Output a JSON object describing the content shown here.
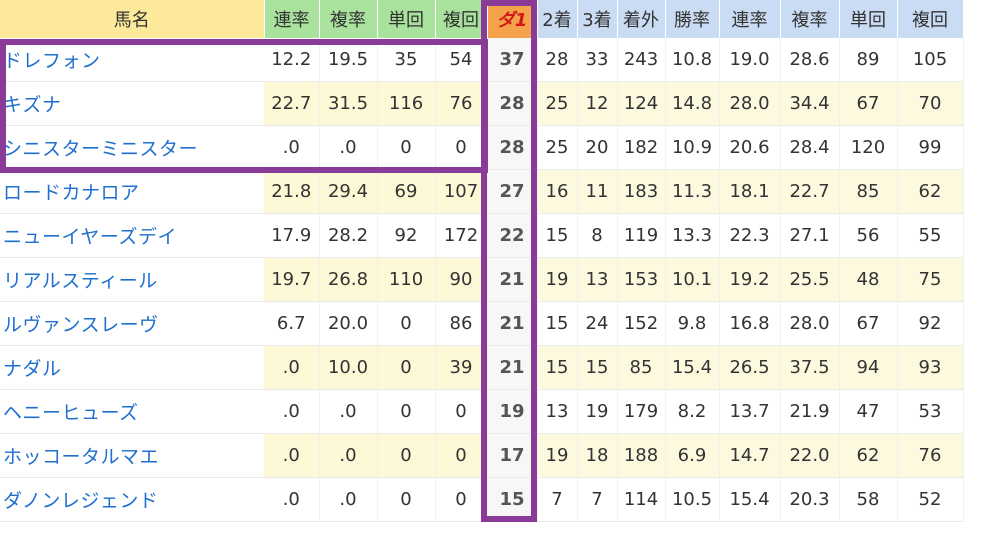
{
  "headers": {
    "name": "馬名",
    "g1": "連率",
    "g2": "複率",
    "g3": "単回",
    "g4": "複回",
    "d1": "ダ1",
    "b1": "2着",
    "b2": "3着",
    "b3": "着外",
    "b4": "勝率",
    "b5": "連率",
    "b6": "複率",
    "b7": "単回",
    "b8": "複回"
  },
  "rows": [
    {
      "name": "ドレフォン",
      "g1": "12.2",
      "g2": "19.5",
      "g3": "35",
      "g4": "54",
      "d1": "37",
      "b1": "28",
      "b2": "33",
      "b3": "243",
      "b4": "10.8",
      "b5": "19.0",
      "b6": "28.6",
      "b7": "89",
      "b8": "105"
    },
    {
      "name": "キズナ",
      "g1": "22.7",
      "g2": "31.5",
      "g3": "116",
      "g4": "76",
      "d1": "28",
      "b1": "25",
      "b2": "12",
      "b3": "124",
      "b4": "14.8",
      "b5": "28.0",
      "b6": "34.4",
      "b7": "67",
      "b8": "70"
    },
    {
      "name": "シニスターミニスター",
      "g1": ".0",
      "g2": ".0",
      "g3": "0",
      "g4": "0",
      "d1": "28",
      "b1": "25",
      "b2": "20",
      "b3": "182",
      "b4": "10.9",
      "b5": "20.6",
      "b6": "28.4",
      "b7": "120",
      "b8": "99"
    },
    {
      "name": "ロードカナロア",
      "g1": "21.8",
      "g2": "29.4",
      "g3": "69",
      "g4": "107",
      "d1": "27",
      "b1": "16",
      "b2": "11",
      "b3": "183",
      "b4": "11.3",
      "b5": "18.1",
      "b6": "22.7",
      "b7": "85",
      "b8": "62"
    },
    {
      "name": "ニューイヤーズデイ",
      "g1": "17.9",
      "g2": "28.2",
      "g3": "92",
      "g4": "172",
      "d1": "22",
      "b1": "15",
      "b2": "8",
      "b3": "119",
      "b4": "13.3",
      "b5": "22.3",
      "b6": "27.1",
      "b7": "56",
      "b8": "55"
    },
    {
      "name": "リアルスティール",
      "g1": "19.7",
      "g2": "26.8",
      "g3": "110",
      "g4": "90",
      "d1": "21",
      "b1": "19",
      "b2": "13",
      "b3": "153",
      "b4": "10.1",
      "b5": "19.2",
      "b6": "25.5",
      "b7": "48",
      "b8": "75"
    },
    {
      "name": "ルヴァンスレーヴ",
      "g1": "6.7",
      "g2": "20.0",
      "g3": "0",
      "g4": "86",
      "d1": "21",
      "b1": "15",
      "b2": "24",
      "b3": "152",
      "b4": "9.8",
      "b5": "16.8",
      "b6": "28.0",
      "b7": "67",
      "b8": "92"
    },
    {
      "name": "ナダル",
      "g1": ".0",
      "g2": "10.0",
      "g3": "0",
      "g4": "39",
      "d1": "21",
      "b1": "15",
      "b2": "15",
      "b3": "85",
      "b4": "15.4",
      "b5": "26.5",
      "b6": "37.5",
      "b7": "94",
      "b8": "93"
    },
    {
      "name": "ヘニーヒューズ",
      "g1": ".0",
      "g2": ".0",
      "g3": "0",
      "g4": "0",
      "d1": "19",
      "b1": "13",
      "b2": "19",
      "b3": "179",
      "b4": "8.2",
      "b5": "13.7",
      "b6": "21.9",
      "b7": "47",
      "b8": "53"
    },
    {
      "name": "ホッコータルマエ",
      "g1": ".0",
      "g2": ".0",
      "g3": "0",
      "g4": "0",
      "d1": "17",
      "b1": "19",
      "b2": "18",
      "b3": "188",
      "b4": "6.9",
      "b5": "14.7",
      "b6": "22.0",
      "b7": "62",
      "b8": "76"
    },
    {
      "name": "ダノンレジェンド",
      "g1": ".0",
      "g2": ".0",
      "g3": "0",
      "g4": "0",
      "d1": "15",
      "b1": "7",
      "b2": "7",
      "b3": "114",
      "b4": "10.5",
      "b5": "15.4",
      "b6": "20.3",
      "b7": "58",
      "b8": "52"
    }
  ]
}
